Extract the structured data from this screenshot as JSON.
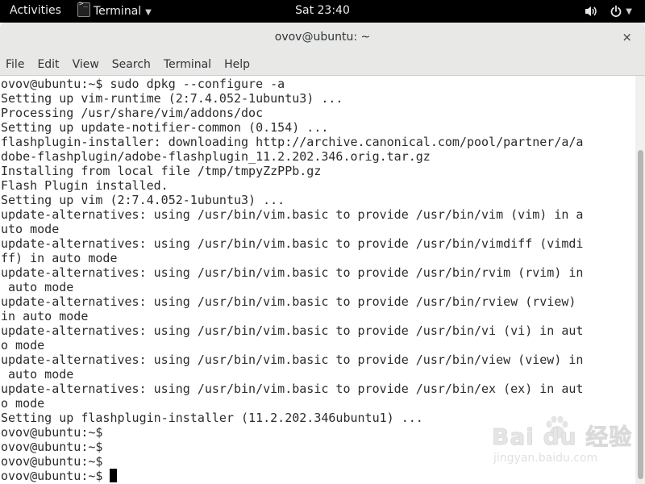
{
  "topbar": {
    "activities_label": "Activities",
    "app_name": "Terminal",
    "app_icon_glyph": ">_",
    "clock": "Sat 23:40",
    "icons": [
      "volume-icon",
      "power-icon"
    ]
  },
  "window": {
    "title": "ovov@ubuntu: ~",
    "close_glyph": "×"
  },
  "menu": [
    "File",
    "Edit",
    "View",
    "Search",
    "Terminal",
    "Help"
  ],
  "terminal": {
    "lines": [
      "ovov@ubuntu:~$ sudo dpkg --configure -a",
      "Setting up vim-runtime (2:7.4.052-1ubuntu3) ...",
      "Processing /usr/share/vim/addons/doc",
      "Setting up update-notifier-common (0.154) ...",
      "flashplugin-installer: downloading http://archive.canonical.com/pool/partner/a/a",
      "dobe-flashplugin/adobe-flashplugin_11.2.202.346.orig.tar.gz",
      "Installing from local file /tmp/tmpyZzPPb.gz",
      "Flash Plugin installed.",
      "Setting up vim (2:7.4.052-1ubuntu3) ...",
      "update-alternatives: using /usr/bin/vim.basic to provide /usr/bin/vim (vim) in a",
      "uto mode",
      "update-alternatives: using /usr/bin/vim.basic to provide /usr/bin/vimdiff (vimdi",
      "ff) in auto mode",
      "update-alternatives: using /usr/bin/vim.basic to provide /usr/bin/rvim (rvim) in",
      " auto mode",
      "update-alternatives: using /usr/bin/vim.basic to provide /usr/bin/rview (rview)",
      "in auto mode",
      "update-alternatives: using /usr/bin/vim.basic to provide /usr/bin/vi (vi) in aut",
      "o mode",
      "update-alternatives: using /usr/bin/vim.basic to provide /usr/bin/view (view) in",
      " auto mode",
      "update-alternatives: using /usr/bin/vim.basic to provide /usr/bin/ex (ex) in aut",
      "o mode",
      "Setting up flashplugin-installer (11.2.202.346ubuntu1) ...",
      "ovov@ubuntu:~$",
      "ovov@ubuntu:~$",
      "ovov@ubuntu:~$",
      "ovov@ubuntu:~$ "
    ]
  },
  "watermark": {
    "main": "Bai du 经验",
    "sub": "jingyan.baidu.com"
  },
  "colors": {
    "topbar_bg": "#000000",
    "chrome_bg": "#e8e8e7",
    "terminal_bg": "#ffffff",
    "terminal_fg": "#2b2b2b"
  }
}
